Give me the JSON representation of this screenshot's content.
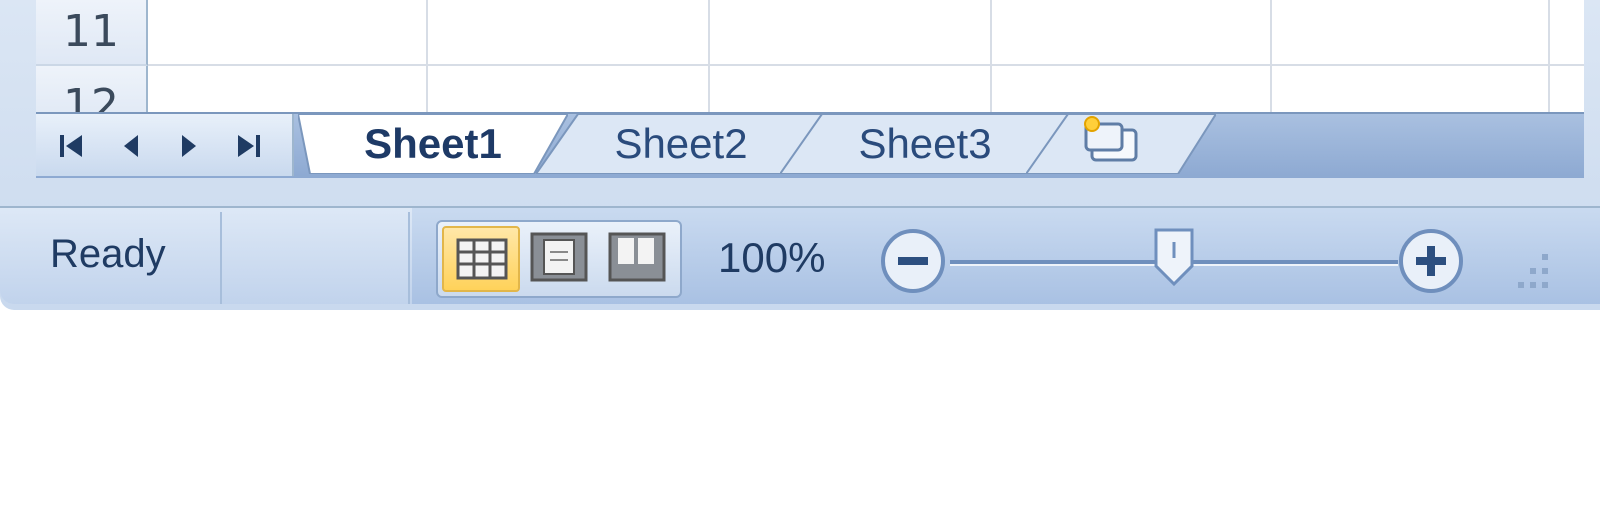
{
  "grid": {
    "row_headers": [
      "11",
      "12"
    ]
  },
  "sheet_tabs": {
    "tabs": [
      {
        "label": "Sheet1",
        "active": true
      },
      {
        "label": "Sheet2",
        "active": false
      },
      {
        "label": "Sheet3",
        "active": false
      }
    ],
    "nav_icons": [
      "first-sheet-icon",
      "previous-sheet-icon",
      "next-sheet-icon",
      "last-sheet-icon"
    ],
    "insert_icon": "insert-sheet-icon"
  },
  "status_bar": {
    "status_text": "Ready",
    "view_buttons": [
      "normal-view-icon",
      "page-layout-view-icon",
      "page-break-preview-icon"
    ],
    "active_view": "normal",
    "zoom_label": "100%",
    "zoom_level": 0.5
  },
  "colors": {
    "accent": "#2a4b7c",
    "active_view": "#ffd25a",
    "tab_bar": "#8da9d2"
  }
}
